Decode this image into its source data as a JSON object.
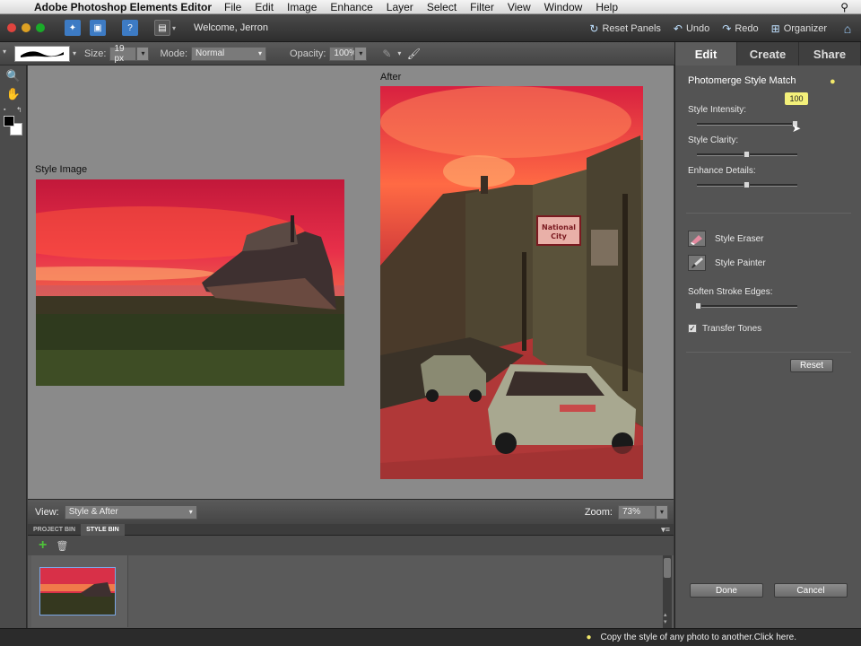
{
  "menubar": {
    "app_name": "Adobe Photoshop Elements Editor",
    "items": [
      "File",
      "Edit",
      "Image",
      "Enhance",
      "Layer",
      "Select",
      "Filter",
      "View",
      "Window",
      "Help"
    ]
  },
  "appbar": {
    "welcome": "Welcome, Jerron",
    "reset_panels": "Reset Panels",
    "undo": "Undo",
    "redo": "Redo",
    "organizer": "Organizer"
  },
  "options": {
    "size_label": "Size:",
    "size_value": "19 px",
    "mode_label": "Mode:",
    "mode_value": "Normal",
    "opacity_label": "Opacity:",
    "opacity_value": "100%"
  },
  "canvas": {
    "style_image_label": "Style Image",
    "after_label": "After"
  },
  "viewbar": {
    "view_label": "View:",
    "view_value": "Style & After",
    "zoom_label": "Zoom:",
    "zoom_value": "73%"
  },
  "bins": {
    "tabs": [
      "PROJECT BIN",
      "STYLE BIN"
    ],
    "active_tab": "STYLE BIN"
  },
  "panel": {
    "tabs": [
      "Edit",
      "Create",
      "Share"
    ],
    "active_tab": "Edit",
    "title": "Photomerge Style Match",
    "tooltip_value": "100",
    "style_intensity_label": "Style Intensity:",
    "style_intensity_value": 1.0,
    "style_clarity_label": "Style Clarity:",
    "style_clarity_value": 0.5,
    "enhance_details_label": "Enhance Details:",
    "enhance_details_value": 0.5,
    "style_eraser": "Style Eraser",
    "style_painter": "Style Painter",
    "soften_label": "Soften Stroke Edges:",
    "soften_value": 0.0,
    "transfer_tones": "Transfer Tones",
    "transfer_tones_checked": true,
    "reset": "Reset",
    "done": "Done",
    "cancel": "Cancel"
  },
  "status": {
    "hint": "Copy the style of any photo to another.Click here."
  }
}
